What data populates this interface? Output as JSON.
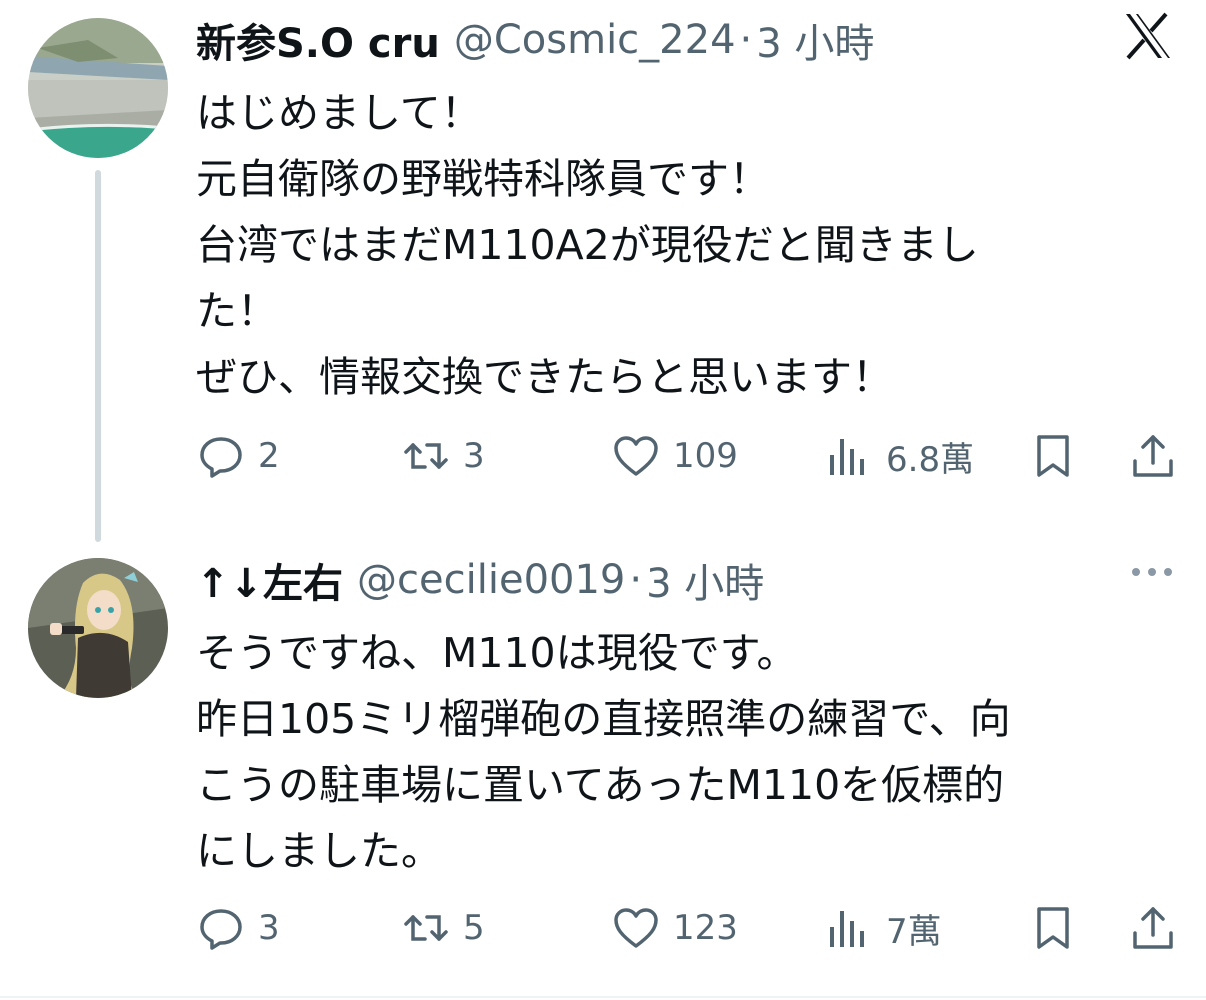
{
  "tweets": [
    {
      "author_name": "新参S.O cru",
      "handle": "@Cosmic_224",
      "separator": "·",
      "time": "3 小時",
      "lines": [
        "はじめまして！",
        "元自衛隊の野戦特科隊員です！",
        "台湾ではまだM110A2が現役だと聞きまし",
        "た！",
        "ぜひ、情報交換できたらと思います！"
      ],
      "replies": "2",
      "retweets": "3",
      "likes": "109",
      "views": "6.8萬",
      "avatar_icon": "coastal-aerial-photo"
    },
    {
      "author_name": "↑↓左右",
      "handle": "@cecilie0019",
      "separator": "·",
      "time": "3 小時",
      "lines": [
        "そうですね、M110は現役です。",
        "昨日105ミリ榴弾砲の直接照準の練習で、向",
        "こうの駐車場に置いてあったM110を仮標的",
        "にしました。"
      ],
      "replies": "3",
      "retweets": "5",
      "likes": "123",
      "views": "7萬",
      "avatar_icon": "anime-character-illustration"
    }
  ],
  "icons": {
    "platform_logo": "x-logo-icon",
    "more": "more-options-icon",
    "reply": "reply-icon",
    "retweet": "retweet-icon",
    "like": "heart-icon",
    "views": "views-chart-icon",
    "bookmark": "bookmark-icon",
    "share": "share-icon"
  },
  "colors": {
    "text_primary": "#0f1419",
    "text_secondary": "#536471",
    "thread_line": "#cfd9de"
  }
}
